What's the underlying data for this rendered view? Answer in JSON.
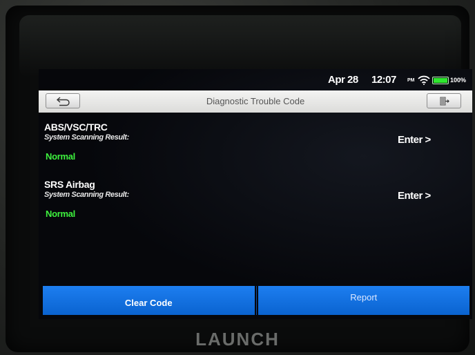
{
  "status_bar": {
    "date": "Apr 28",
    "time": "12:07",
    "ampm": "PM",
    "battery_percent": "100%",
    "battery_level": 1.0,
    "icons": [
      "wifi-icon",
      "battery-icon"
    ]
  },
  "header": {
    "title": "Diagnostic Trouble Code",
    "back_icon": "back-arrow-icon",
    "exit_icon": "exit-icon"
  },
  "systems": [
    {
      "name": "ABS/VSC/TRC",
      "result_label": "System Scanning Result:",
      "status": "Normal",
      "enter_label": "Enter >"
    },
    {
      "name": "SRS Airbag",
      "result_label": "System Scanning Result:",
      "status": "Normal",
      "enter_label": "Enter >"
    }
  ],
  "actions": {
    "clear_code": "Clear Code",
    "report": "Report"
  },
  "device": {
    "brand": "LAUNCH"
  },
  "colors": {
    "accent_blue": "#1d7ef0",
    "status_green": "#3ef23e",
    "screen_bg": "#06070b"
  }
}
